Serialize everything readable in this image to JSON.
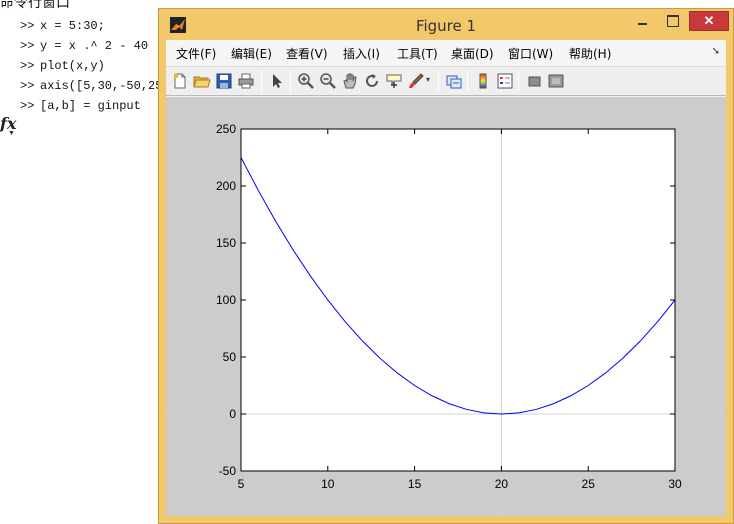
{
  "command_window": {
    "title": "命令行窗口",
    "prompt": ">>",
    "lines": [
      "x = 5:30;",
      "y = x .^ 2 - 40 .",
      "plot(x,y)",
      "axis([5,30,-50,25",
      "[a,b] = ginput"
    ],
    "fx_icon": "fx"
  },
  "figure_window": {
    "title": "Figure 1",
    "close_label": "✕",
    "menu": [
      "文件(F)",
      "编辑(E)",
      "查看(V)",
      "插入(I)",
      "工具(T)",
      "桌面(D)",
      "窗口(W)",
      "帮助(H)"
    ],
    "toolbar_icons": [
      "new-figure-icon",
      "open-file-icon",
      "save-icon",
      "print-icon",
      "edit-plot-arrow-icon",
      "zoom-in-icon",
      "zoom-out-icon",
      "pan-icon",
      "rotate-3d-icon",
      "data-cursor-icon",
      "brush-icon",
      "link-plot-icon",
      "colorbar-icon",
      "legend-icon",
      "hide-plot-tools-icon",
      "show-plot-tools-icon"
    ],
    "colors": {
      "frame": "#f3c86a",
      "close_button": "#c7393a",
      "line": "#0000ff",
      "canvas": "#cccccc"
    }
  },
  "chart_data": {
    "type": "line",
    "title": "",
    "xlabel": "",
    "ylabel": "",
    "xlim": [
      5,
      30
    ],
    "ylim": [
      -50,
      250
    ],
    "xticks": [
      5,
      10,
      15,
      20,
      25,
      30
    ],
    "yticks": [
      -50,
      0,
      50,
      100,
      150,
      200,
      250
    ],
    "crosshair": {
      "x": 20,
      "y": 0
    },
    "series": [
      {
        "color": "#0000ff",
        "x": [
          5,
          6,
          7,
          8,
          9,
          10,
          11,
          12,
          13,
          14,
          15,
          16,
          17,
          18,
          19,
          20,
          21,
          22,
          23,
          24,
          25,
          26,
          27,
          28,
          29,
          30
        ],
        "y": [
          225,
          196,
          169,
          144,
          121,
          100,
          81,
          64,
          49,
          36,
          25,
          16,
          9,
          4,
          1,
          0,
          1,
          4,
          9,
          16,
          25,
          36,
          49,
          64,
          81,
          100
        ]
      }
    ]
  }
}
